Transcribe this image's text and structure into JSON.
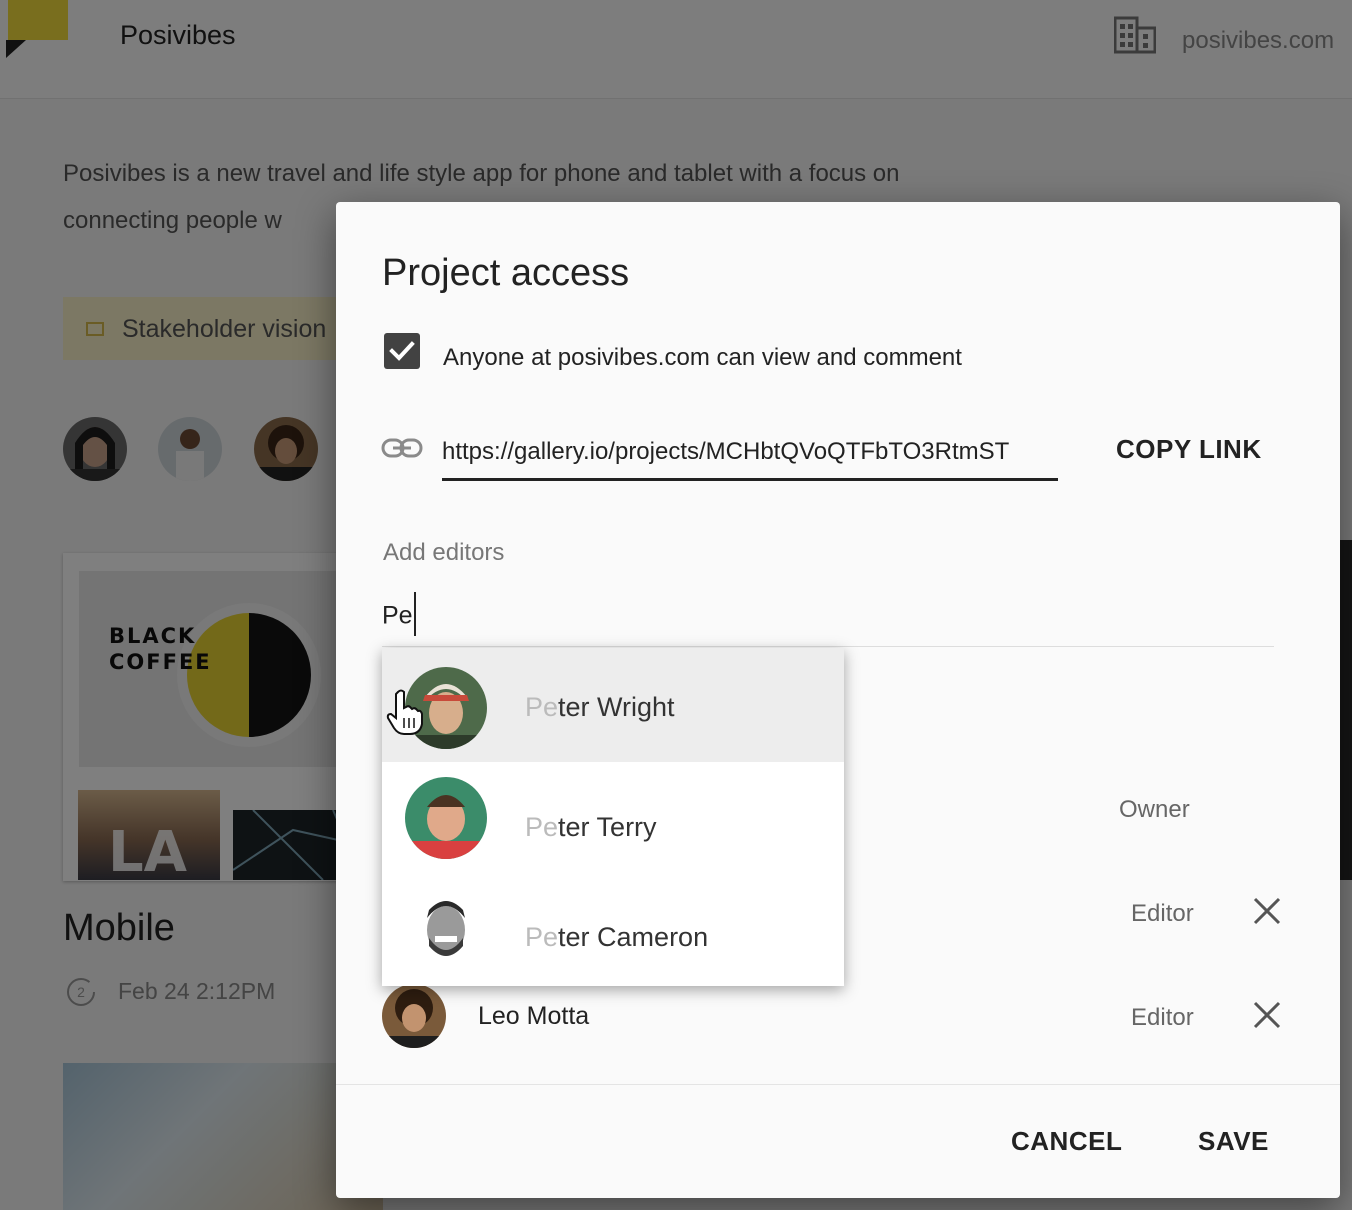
{
  "app": {
    "name": "Posivibes",
    "org_domain": "posivibes.com",
    "brand_color": "#f2dc3c"
  },
  "project": {
    "description": "Posivibes is a new travel and life style app for phone and tablet   with a focus on connecting people w",
    "vision_label": "Stakeholder vision",
    "card_title": "Mobile",
    "card_date": "Feb 24 2:12PM",
    "history_count": "2",
    "thumb_coffee_text": "BLACK COFFEE",
    "thumb_la_text": "LA"
  },
  "dialog": {
    "title": "Project access",
    "checkbox_checked": true,
    "checkbox_label": "Anyone at posivibes.com can view and comment",
    "link_url": "https://gallery.io/projects/MCHbtQVoQTFbTO3RtmST",
    "copy_link_label": "COPY LINK",
    "add_editors_label": "Add editors",
    "add_editors_value": "Pe",
    "members": [
      {
        "name": "",
        "role": "Owner",
        "removable": false
      },
      {
        "name": "",
        "role": "Editor",
        "removable": true
      },
      {
        "name": "Leo Motta",
        "role": "Editor",
        "removable": true
      }
    ],
    "cancel_label": "CANCEL",
    "save_label": "SAVE"
  },
  "suggestions": [
    {
      "match": "Pe",
      "rest": "ter Wright",
      "hovered": true
    },
    {
      "match": "Pe",
      "rest": "ter Terry",
      "hovered": false
    },
    {
      "match": "Pe",
      "rest": "ter Cameron",
      "hovered": false
    }
  ]
}
